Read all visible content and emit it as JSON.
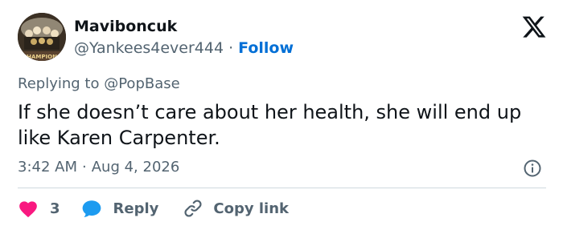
{
  "author": {
    "name": "Maviboncuk",
    "handle": "@Yankees4ever444",
    "separator": "·",
    "follow_label": "Follow"
  },
  "reply_context": {
    "prefix": "Replying to",
    "mention": "@PopBase"
  },
  "tweet": {
    "text": "If she doesn’t care about her health, she will end up like Karen Carpenter.",
    "time": "3:42 AM",
    "separator": "·",
    "date": "Aug 4, 2026"
  },
  "actions": {
    "like_count": "3",
    "reply_label": "Reply",
    "copy_label": "Copy link"
  },
  "colors": {
    "text": "#0f1419",
    "secondary": "#536471",
    "follow": "#006fd6",
    "like": "#f91880",
    "reply": "#1d9bf0",
    "divider": "#cfd9de"
  },
  "icons": {
    "logo": "x-logo-icon",
    "info": "info-icon",
    "like": "heart-icon",
    "reply": "speech-bubble-icon",
    "copy": "link-icon"
  }
}
